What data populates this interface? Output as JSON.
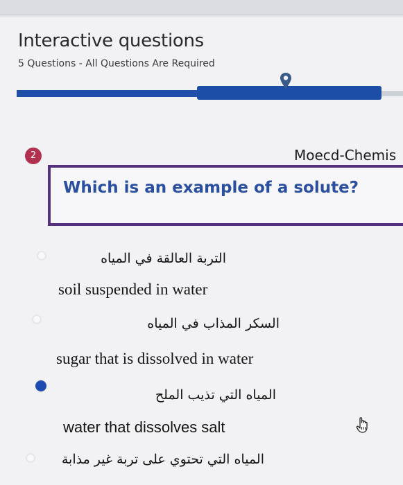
{
  "header": {
    "title": "Interactive questions",
    "subtitle": "5 Questions - All Questions Are Required"
  },
  "progress": {
    "current_question": 2,
    "total_questions": 5
  },
  "question": {
    "number": "2",
    "course": "Moecd-Chemis",
    "text": "Which is an example of a solute?"
  },
  "options": [
    {
      "arabic": "التربة العالقة في المياه",
      "english": "soil suspended in water",
      "selected": false
    },
    {
      "arabic": "السكر المذاب في المياه",
      "english": "sugar that is dissolved in water",
      "selected": false
    },
    {
      "arabic": "المياه التي تذيب الملح",
      "english": "water that dissolves salt",
      "selected": true
    },
    {
      "arabic": "المياه التي تحتوي على تربة غير مذابة",
      "english": "",
      "selected": false
    }
  ],
  "colors": {
    "progress": "#1d4ea5",
    "question_border": "#55307f",
    "question_text": "#2a4f9e",
    "badge": "#b1304d"
  },
  "icons": [
    "location-pin-icon",
    "hand-pointer-icon"
  ]
}
